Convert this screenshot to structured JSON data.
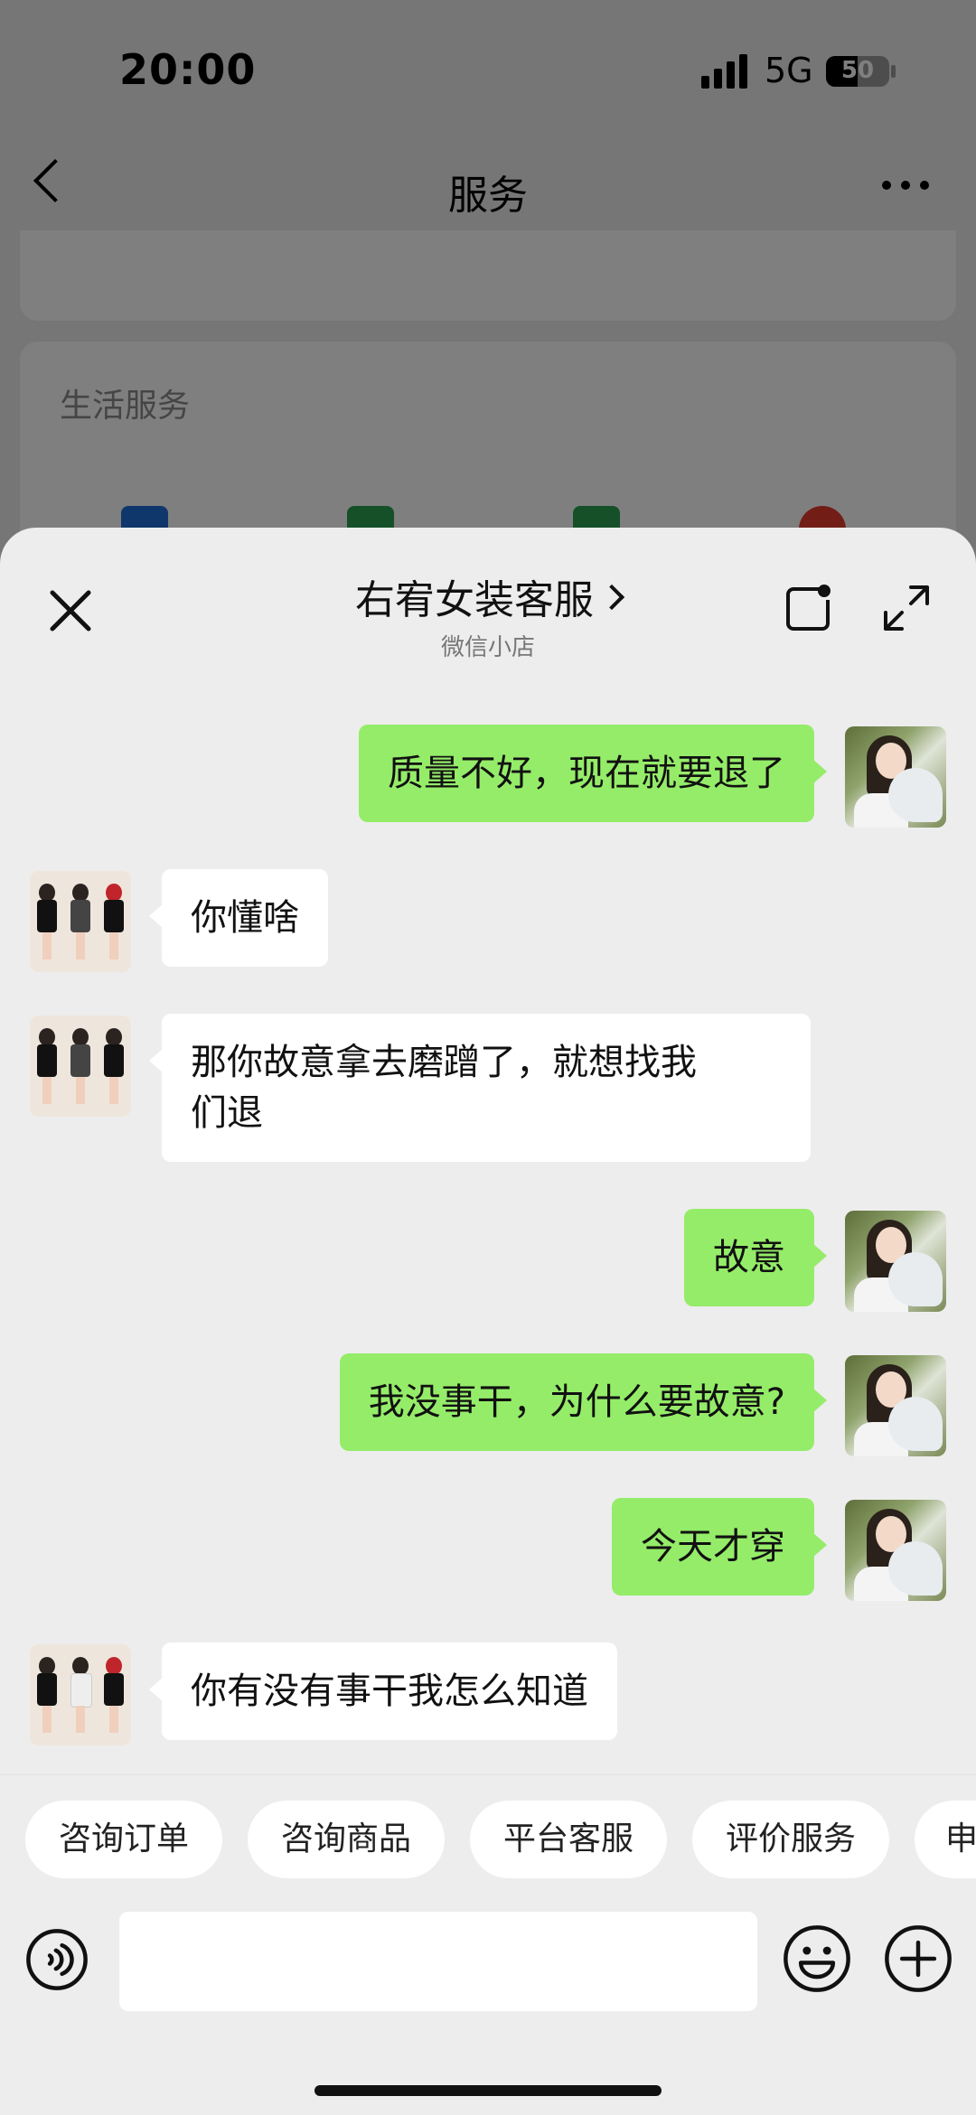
{
  "status_bar": {
    "time": "20:00",
    "network": "5G",
    "battery": "50"
  },
  "background_page": {
    "title": "服务",
    "section_title": "生活服务",
    "service_icon_colors": [
      "#1f6fd6",
      "#2aa150",
      "#2aa150",
      "#e53c2e"
    ]
  },
  "chat": {
    "title": "右宥女装客服",
    "subtitle": "微信小店",
    "messages": [
      {
        "from": "me",
        "text": "质量不好，现在就要退了"
      },
      {
        "from": "them",
        "text": "你懂啥"
      },
      {
        "from": "them",
        "text": "那你故意拿去磨蹭了，就想找我\n们退"
      },
      {
        "from": "me",
        "text": "故意"
      },
      {
        "from": "me",
        "text": "我没事干，为什么要故意?"
      },
      {
        "from": "me",
        "text": "今天才穿"
      },
      {
        "from": "them",
        "text": "你有没有事干我怎么知道"
      }
    ],
    "quick_replies": [
      "咨询订单",
      "咨询商品",
      "平台客服",
      "评价服务",
      "申"
    ],
    "input_placeholder": ""
  },
  "colors": {
    "my_bubble": "#95ec69",
    "their_bubble": "#ffffff",
    "sheet_bg": "#ededed"
  }
}
